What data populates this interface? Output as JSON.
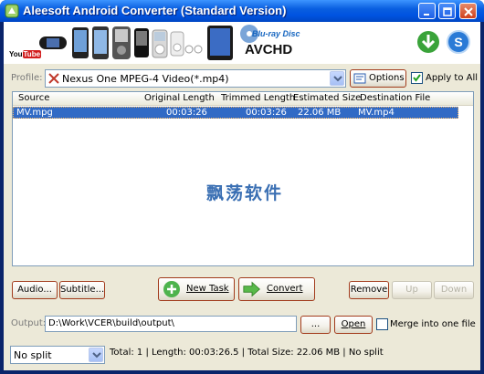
{
  "window": {
    "title": "Aleesoft Android Converter (Standard Version)"
  },
  "banner": {
    "youtube_label": "You",
    "youtube_label_box": "Tube",
    "bluray_label": "Blu-ray Disc",
    "avchd_label": "AVCHD"
  },
  "profile": {
    "label": "Profile:",
    "value": "Nexus One MPEG-4 Video(*.mp4)",
    "options_label": "Options",
    "apply_all_label": "Apply to All",
    "apply_all_checked": true
  },
  "list": {
    "columns": [
      "Source",
      "Original Length",
      "Trimmed Length",
      "Estimated Size",
      "Destination File"
    ],
    "rows": [
      {
        "source": "MV.mpg",
        "original_length": "00:03:26",
        "trimmed_length": "00:03:26",
        "estimated_size": "22.06 MB",
        "destination": "MV.mp4"
      }
    ],
    "watermark": "飘荡软件"
  },
  "actions": {
    "audio": "Audio...",
    "subtitle": "Subtitle...",
    "new_task": "New Task",
    "convert": "Convert",
    "remove": "Remove",
    "up": "Up",
    "down": "Down"
  },
  "output": {
    "label": "Output:",
    "path": "D:\\Work\\VCER\\build\\output\\",
    "browse": "...",
    "open": "Open",
    "merge_label": "Merge into one file",
    "merge_checked": false
  },
  "status": {
    "split_value": "No split",
    "summary": "Total: 1 | Length: 00:03:26.5 | Total Size: 22.06 MB | No split"
  },
  "colors": {
    "titlebar": "#0054e3",
    "selection": "#316ac5",
    "face": "#ece9d8"
  }
}
